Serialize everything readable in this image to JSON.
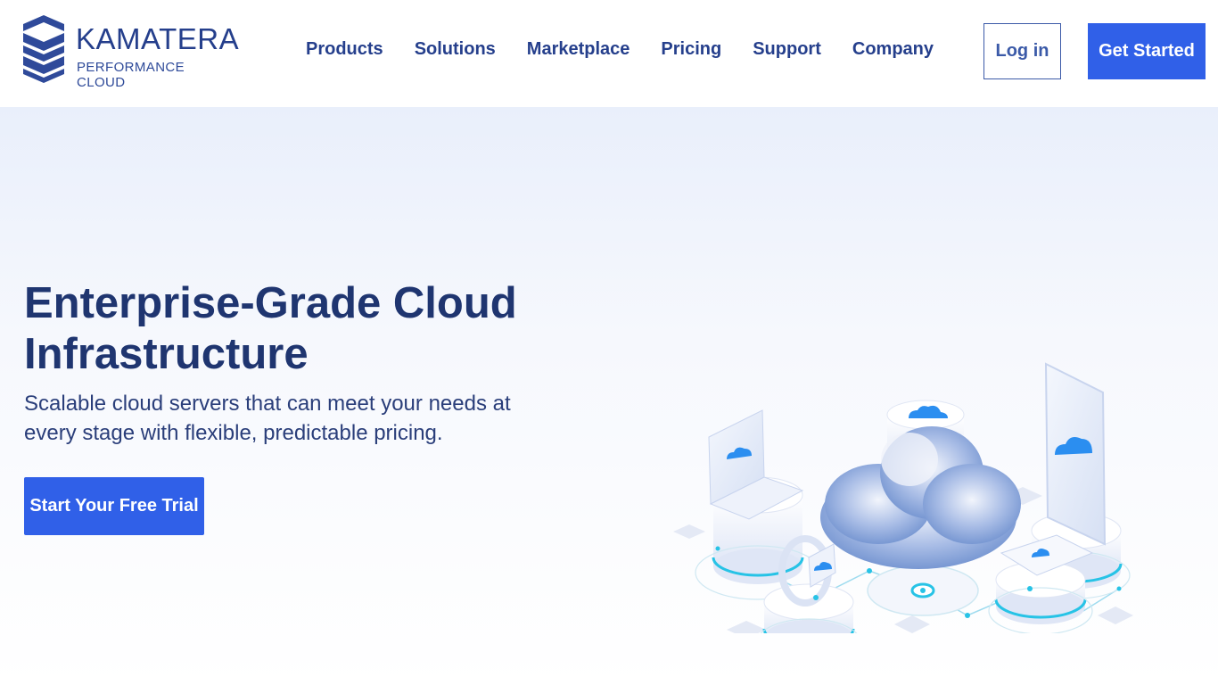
{
  "logo": {
    "name": "KAMATERA",
    "tagline": "PERFORMANCE CLOUD"
  },
  "nav": {
    "items": [
      {
        "label": "Products"
      },
      {
        "label": "Solutions"
      },
      {
        "label": "Marketplace"
      },
      {
        "label": "Pricing"
      },
      {
        "label": "Support"
      },
      {
        "label": "Company"
      }
    ]
  },
  "header": {
    "login_label": "Log in",
    "get_started_label": "Get Started"
  },
  "hero": {
    "title": "Enterprise-Grade Cloud Infrastructure",
    "subtitle": "Scalable cloud servers that can meet your needs at every stage with flexible, predictable pricing.",
    "cta_label": "Start Your Free Trial"
  },
  "colors": {
    "brand": "#253f8c",
    "accent": "#3060e8",
    "cyan": "#27c3e6",
    "cloud": "#4a7fe0"
  },
  "illustration": {
    "icons": [
      "laptop-icon",
      "database-icon",
      "phone-icon",
      "smartwatch-icon",
      "tablet-icon",
      "cloud-icon"
    ]
  }
}
